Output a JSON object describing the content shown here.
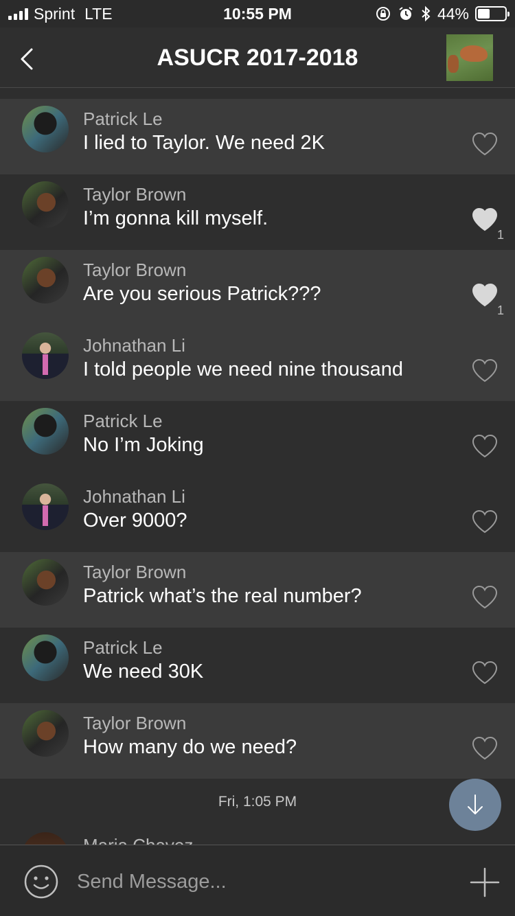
{
  "status_bar": {
    "carrier": "Sprint",
    "network": "LTE",
    "time": "10:55 PM",
    "battery": "44%",
    "battery_level": 0.44
  },
  "nav": {
    "title": "ASUCR 2017-2018"
  },
  "messages": [
    {
      "author": "Patrick Le",
      "text": "I lied to Taylor. We need 2K",
      "likes": "",
      "liked": false
    },
    {
      "author": "Taylor Brown",
      "text": "I’m gonna kill myself.",
      "likes": "1",
      "liked": true
    },
    {
      "author": "Taylor Brown",
      "text": "Are you serious Patrick???",
      "likes": "1",
      "liked": true
    },
    {
      "author": "Johnathan Li",
      "text": "I told people we need nine thousand",
      "likes": "",
      "liked": false
    },
    {
      "author": "Patrick Le",
      "text": "No I’m Joking",
      "likes": "",
      "liked": false
    },
    {
      "author": "Johnathan Li",
      "text": "Over 9000?",
      "likes": "",
      "liked": false
    },
    {
      "author": "Taylor Brown",
      "text": "Patrick what’s the real number?",
      "likes": "",
      "liked": false
    },
    {
      "author": "Patrick Le",
      "text": "We need 30K",
      "likes": "",
      "liked": false
    },
    {
      "author": "Taylor Brown",
      "text": "How many do we need?",
      "likes": "",
      "liked": false
    }
  ],
  "date_separator": "Fri, 1:05 PM",
  "partial_message": {
    "author": "Maria Chavez"
  },
  "composer": {
    "placeholder": "Send Message..."
  },
  "icons": {
    "back": "chevron-left-icon",
    "like": "heart-icon",
    "scroll": "arrow-down-icon",
    "emoji": "smiley-icon",
    "add": "plus-icon"
  },
  "colors": {
    "background": "#2e2e2e",
    "row_shade": "#3b3b3b",
    "scroll_button": "#6d8299",
    "heart_filled": "#d8d8d8"
  }
}
